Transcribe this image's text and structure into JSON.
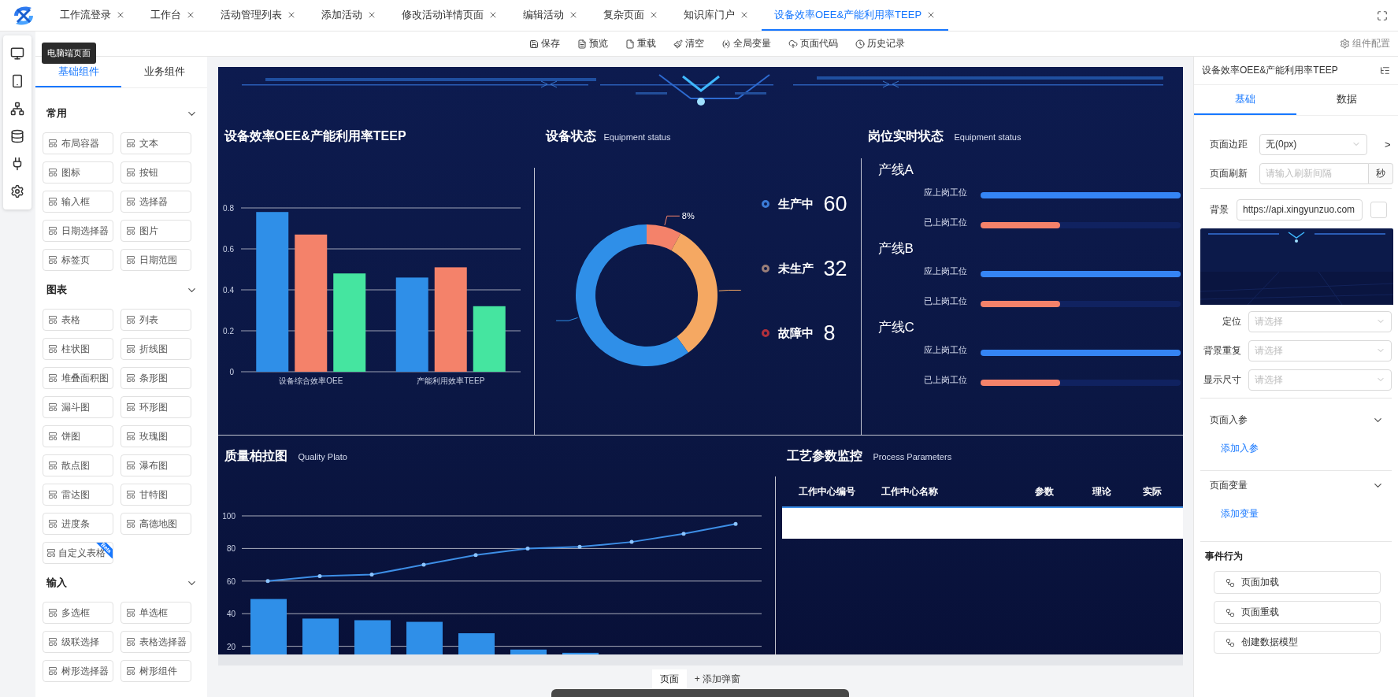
{
  "tabs": [
    {
      "label": "工作流登录",
      "selected": false
    },
    {
      "label": "工作台",
      "selected": false
    },
    {
      "label": "活动管理列表",
      "selected": false
    },
    {
      "label": "添加活动",
      "selected": false
    },
    {
      "label": "修改活动详情页面",
      "selected": false
    },
    {
      "label": "编辑活动",
      "selected": false
    },
    {
      "label": "复杂页面",
      "selected": false
    },
    {
      "label": "知识库门户",
      "selected": false
    },
    {
      "label": "设备效率OEE&产能利用率TEEP",
      "selected": true
    }
  ],
  "rail": {
    "tooltip": "电脑端页面"
  },
  "toolbar": {
    "actions": [
      "保存",
      "预览",
      "重载",
      "清空",
      "全局变量",
      "页面代码",
      "历史记录"
    ],
    "config": "组件配置"
  },
  "left_panel": {
    "tabs": [
      {
        "label": "基础组件",
        "selected": true
      },
      {
        "label": "业务组件",
        "selected": false
      }
    ],
    "sections": [
      {
        "title": "常用",
        "expanded": true,
        "items": [
          {
            "label": "布局容器"
          },
          {
            "label": "文本"
          },
          {
            "label": "图标"
          },
          {
            "label": "按钮"
          },
          {
            "label": "输入框"
          },
          {
            "label": "选择器"
          },
          {
            "label": "日期选择器"
          },
          {
            "label": "图片"
          },
          {
            "label": "标签页"
          },
          {
            "label": "日期范围"
          }
        ]
      },
      {
        "title": "图表",
        "expanded": true,
        "items": [
          {
            "label": "表格"
          },
          {
            "label": "列表"
          },
          {
            "label": "柱状图"
          },
          {
            "label": "折线图"
          },
          {
            "label": "堆叠面积图"
          },
          {
            "label": "条形图"
          },
          {
            "label": "漏斗图"
          },
          {
            "label": "环形图"
          },
          {
            "label": "饼图"
          },
          {
            "label": "玫瑰图"
          },
          {
            "label": "散点图"
          },
          {
            "label": "瀑布图"
          },
          {
            "label": "雷达图"
          },
          {
            "label": "甘特图"
          },
          {
            "label": "进度条"
          },
          {
            "label": "高德地图"
          },
          {
            "label": "自定义表格",
            "badge": "Beta"
          }
        ]
      },
      {
        "title": "输入",
        "expanded": true,
        "items": [
          {
            "label": "多选框"
          },
          {
            "label": "单选框"
          },
          {
            "label": "级联选择"
          },
          {
            "label": "表格选择器"
          },
          {
            "label": "树形选择器"
          },
          {
            "label": "树形组件"
          }
        ]
      }
    ]
  },
  "dashboard": {
    "oee_panel": {
      "title": "设备效率OEE&产能利用率TEEP",
      "chart_data": {
        "type": "bar",
        "categories": [
          "设备综合效率OEE",
          "产能利用效率TEEP"
        ],
        "series": [
          {
            "color": "#2f8fe8",
            "values": [
              0.78,
              0.46
            ]
          },
          {
            "color": "#f4826a",
            "values": [
              0.67,
              0.51
            ]
          },
          {
            "color": "#45e5a0",
            "values": [
              0.48,
              0.32
            ]
          }
        ],
        "grid": true,
        "ylim": [
          0,
          0.8
        ],
        "yticks": [
          0,
          0.2,
          0.4,
          0.6,
          0.8
        ]
      }
    },
    "status_panel": {
      "title": "设备状态",
      "subtitle": "Equipment status",
      "chart_data": {
        "type": "donut",
        "values": [
          60,
          32,
          8
        ],
        "colors": [
          "#2f8fe8",
          "#f5a862",
          "#f4826a"
        ],
        "value_labels": [
          null,
          null,
          "8%"
        ]
      },
      "legend": [
        {
          "label": "生产中",
          "value": "60",
          "color": "#3b7bd6"
        },
        {
          "label": "未生产",
          "value": "32",
          "color": "#9a7e78"
        },
        {
          "label": "故障中",
          "value": "8",
          "color": "#b0303c"
        }
      ]
    },
    "station_panel": {
      "title": "岗位实时状态",
      "subtitle": "Equipment status",
      "lines": [
        {
          "name": "产线A",
          "bars": [
            {
              "label": "应上岗工位",
              "level": 1,
              "color": "#3585f5"
            },
            {
              "label": "已上岗工位",
              "level": 0.4,
              "color": "#f4826a"
            }
          ]
        },
        {
          "name": "产线B",
          "bars": [
            {
              "label": "应上岗工位",
              "level": 1,
              "color": "#3585f5"
            },
            {
              "label": "已上岗工位",
              "level": 0.4,
              "color": "#f4826a"
            }
          ]
        },
        {
          "name": "产线C",
          "bars": [
            {
              "label": "应上岗工位",
              "level": 1,
              "color": "#3585f5"
            },
            {
              "label": "已上岗工位",
              "level": 0.4,
              "color": "#f4826a"
            }
          ]
        }
      ]
    },
    "pareto_panel": {
      "title": "质量柏拉图",
      "subtitle": "Quality Plato",
      "chart_data": {
        "type": "bar",
        "series": [
          {
            "type": "bar",
            "color": "#2f8fe8",
            "values": [
              49,
              37,
              36,
              35,
              28,
              18,
              16,
              null,
              null,
              null
            ]
          },
          {
            "type": "line",
            "color": "#3d8ee6",
            "values": [
              60,
              63,
              64,
              70,
              76,
              80,
              81,
              84,
              89,
              95
            ]
          }
        ],
        "grid": true,
        "ylim": [
          14.5,
          100
        ],
        "yticks": [
          20,
          40,
          60,
          80,
          100
        ]
      }
    },
    "process_panel": {
      "title": "工艺参数监控",
      "subtitle": "Process Parameters",
      "columns": [
        "工作中心编号",
        "工作中心名称",
        "参数",
        "理论",
        "实际"
      ]
    }
  },
  "page_tabs": [
    {
      "label": "页面",
      "selected": true
    },
    {
      "label": "+ 添加弹窗",
      "selected": false
    }
  ],
  "right_panel": {
    "title": "设备效率OEE&产能利用率TEEP",
    "tabs": [
      {
        "label": "基础",
        "selected": true
      },
      {
        "label": "数据",
        "selected": false
      }
    ],
    "margin": {
      "label": "页面边距",
      "value": "无(0px)",
      "more": ">"
    },
    "refresh": {
      "label": "页面刷新",
      "placeholder": "请输入刷新间隔",
      "unit": "秒"
    },
    "background": {
      "label": "背景",
      "value": "https://api.xingyunzuo.com"
    },
    "selects": [
      {
        "label": "定位",
        "placeholder": "请选择"
      },
      {
        "label": "背景重复",
        "placeholder": "请选择"
      },
      {
        "label": "显示尺寸",
        "placeholder": "请选择"
      }
    ],
    "params": {
      "title": "页面入参",
      "expanded": true,
      "link": "添加入参"
    },
    "variables": {
      "title": "页面变量",
      "expanded": true,
      "link": "添加变量"
    },
    "events": {
      "title": "事件行为",
      "actions": [
        "页面加载",
        "页面重载",
        "创建数据模型"
      ]
    }
  }
}
